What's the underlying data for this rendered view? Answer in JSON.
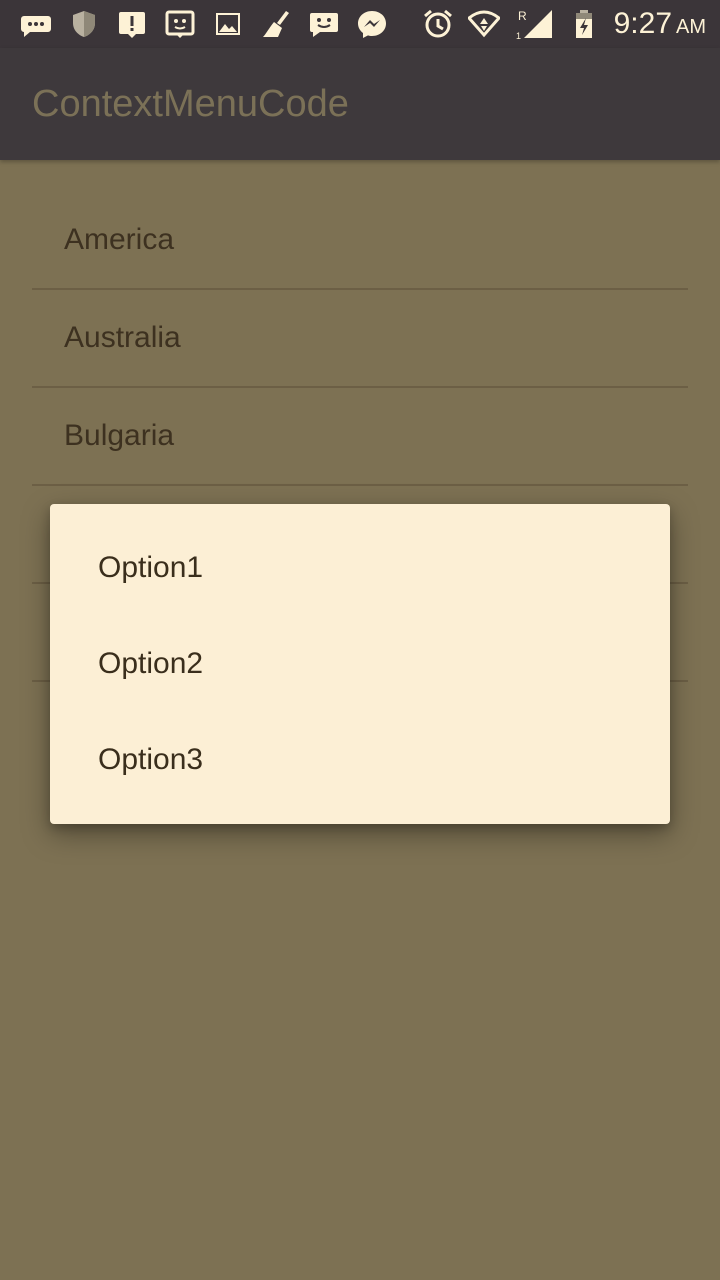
{
  "status_bar": {
    "time": "9:27",
    "ampm": "AM",
    "left_icons": [
      "chat-dots-icon",
      "shield-icon",
      "alert-icon",
      "face-icon",
      "image-icon",
      "broom-icon",
      "smiley-message-icon",
      "messenger-icon"
    ],
    "right_icons": [
      "alarm-icon",
      "wifi-icon",
      "signal-icon",
      "battery-icon"
    ],
    "signal_label": "R",
    "signal_sub": "1",
    "icon_color": "#fdf2d6",
    "background": "#3b3539"
  },
  "app_bar": {
    "title": "ContextMenuCode",
    "background": "#3e393c",
    "title_color": "#7b7157"
  },
  "list": {
    "items": [
      "America",
      "Australia",
      "Bulgaria",
      "",
      ""
    ]
  },
  "context_menu": {
    "options": [
      "Option1",
      "Option2",
      "Option3"
    ],
    "background": "#fcefd5"
  },
  "colors": {
    "scrim_background": "#7d7153",
    "list_text": "#3d3120",
    "divider": "#6c5f45"
  }
}
